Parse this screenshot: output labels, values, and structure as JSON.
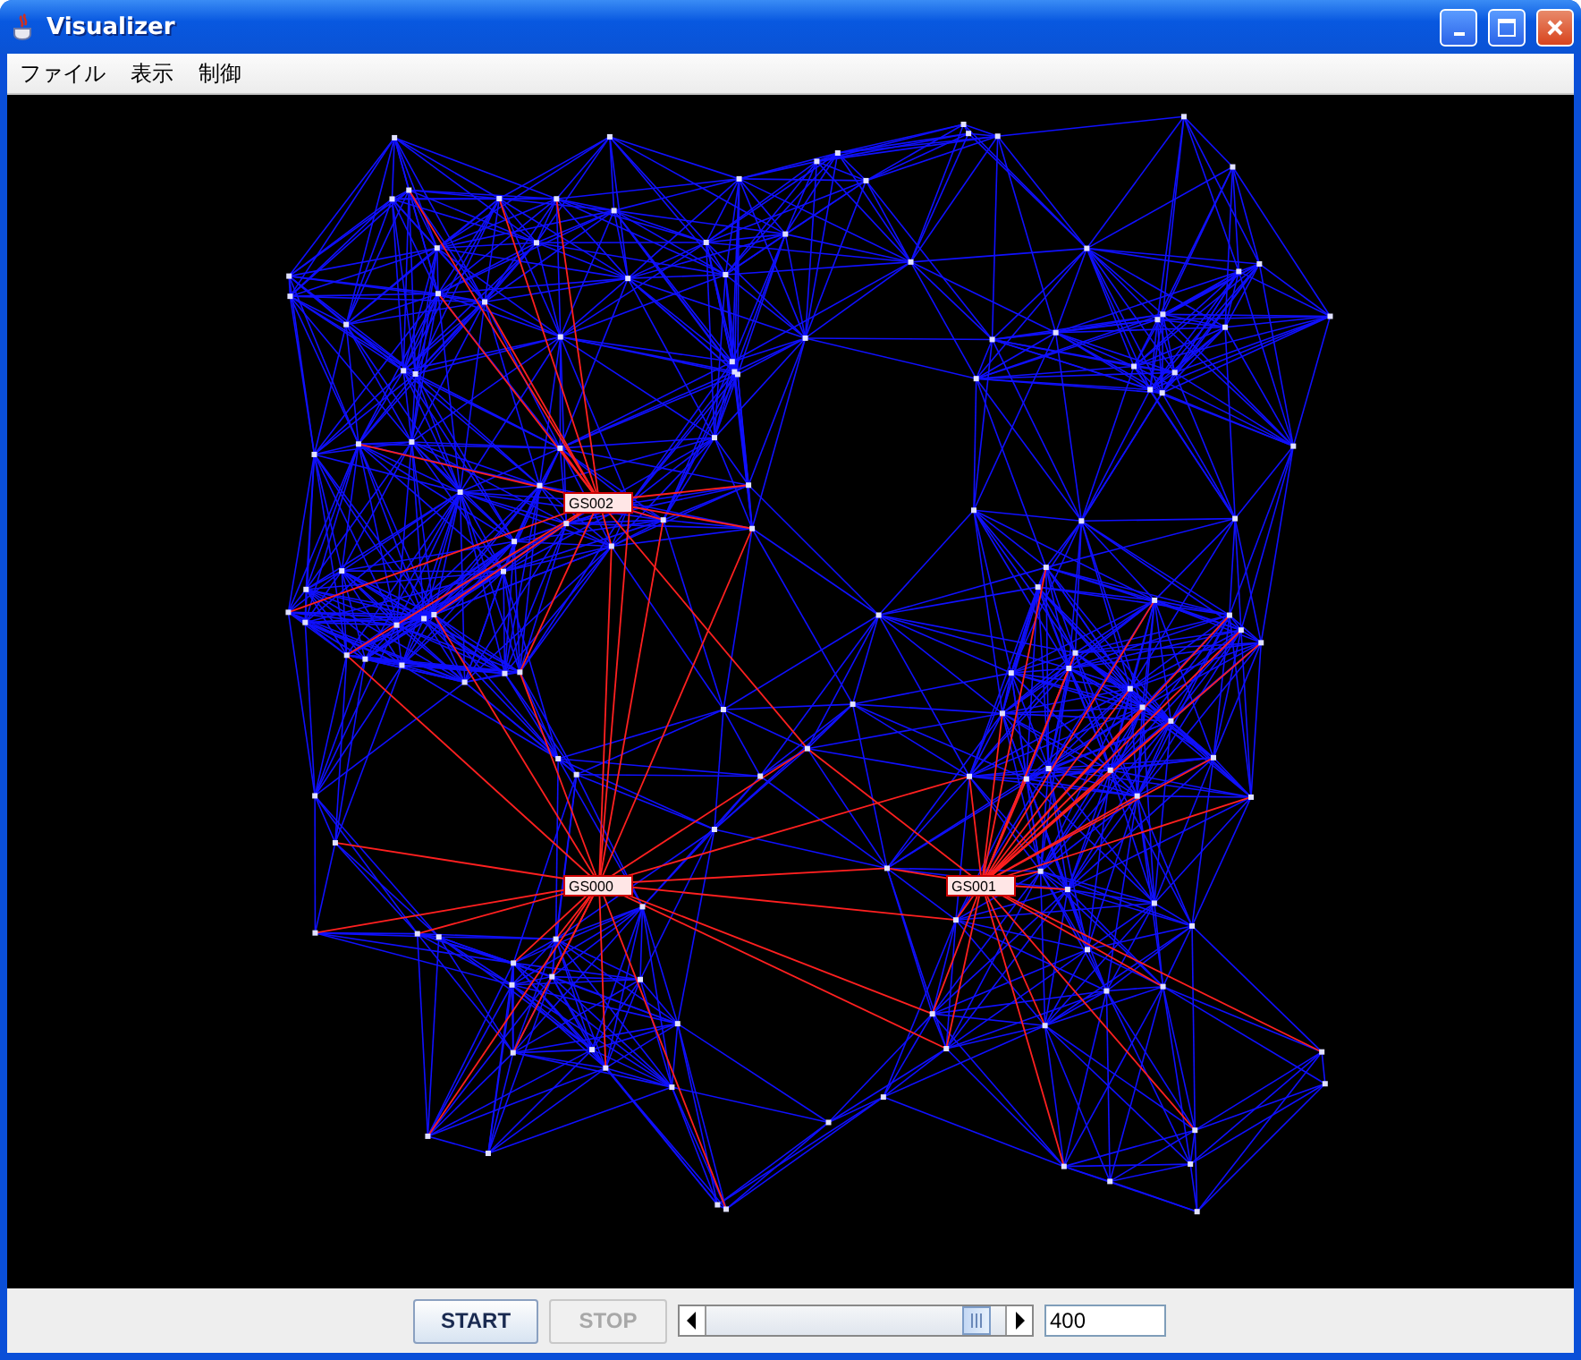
{
  "window": {
    "title": "Visualizer"
  },
  "menu": [
    {
      "label": "ファイル"
    },
    {
      "label": "表示"
    },
    {
      "label": "制御"
    }
  ],
  "stations": [
    {
      "label": "GS002"
    },
    {
      "label": "GS000"
    },
    {
      "label": "GS001"
    }
  ],
  "controls": {
    "start": {
      "label": "START",
      "disabled": false
    },
    "stop": {
      "label": "STOP",
      "disabled": true
    },
    "speed_slider": {
      "level": 0.95
    },
    "speed_field": {
      "value": "400"
    }
  }
}
